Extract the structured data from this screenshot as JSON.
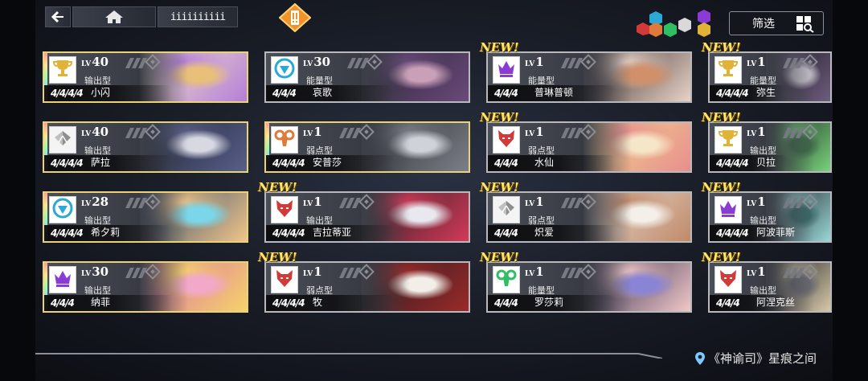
{
  "topbar": {
    "title": "iiiiiiiiii"
  },
  "filter": {
    "label": "筛选"
  },
  "colors": {
    "gold": "#e7c34a",
    "new": "#ffe36a",
    "frame": "#b9b9bd",
    "red": "#d23a3a",
    "purple": "#8a3bd6",
    "cyan": "#2aa8d6",
    "green": "#2fbf62"
  },
  "new_label": "NEW!",
  "cards": [
    {
      "id": "xiaoshan",
      "lv": "40",
      "type": "输出型",
      "name": "小闪",
      "icon": "trophy-icon",
      "icon_color": "#e0b236",
      "stars": "4/4/4/4",
      "new": false,
      "rainbow": true,
      "col": 0,
      "row": 0
    },
    {
      "id": "aige",
      "lv": "30",
      "type": "能量型",
      "name": "哀歌",
      "icon": "shield-icon",
      "icon_color": "#2aa8d6",
      "stars": "4/4/4",
      "new": false,
      "rainbow": false,
      "col": 1,
      "row": 0
    },
    {
      "id": "pulinpudun",
      "lv": "1",
      "type": "能量型",
      "name": "普琳普顿",
      "icon": "crown-icon",
      "icon_color": "#8a3bd6",
      "stars": "4/4/4",
      "new": true,
      "rainbow": false,
      "col": 2,
      "row": 0
    },
    {
      "id": "misheng",
      "lv": "1",
      "type": "能量型",
      "name": "弥生",
      "icon": "trophy-icon",
      "icon_color": "#e0b236",
      "stars": "4/4/4/4",
      "new": true,
      "rainbow": false,
      "col": 3,
      "row": 0
    },
    {
      "id": "sala",
      "lv": "40",
      "type": "输出型",
      "name": "萨拉",
      "icon": "wings-icon",
      "icon_color": "#d9d9d9",
      "stars": "4/4/4/4",
      "new": false,
      "rainbow": true,
      "col": 0,
      "row": 1
    },
    {
      "id": "anpusha",
      "lv": "1",
      "type": "弱点型",
      "name": "安普莎",
      "icon": "ram-icon",
      "icon_color": "#e07a3a",
      "stars": "4/4/4/4",
      "new": false,
      "rainbow": true,
      "col": 1,
      "row": 1
    },
    {
      "id": "shuixian",
      "lv": "1",
      "type": "弱点型",
      "name": "水仙",
      "icon": "wolf-icon",
      "icon_color": "#d23a3a",
      "stars": "4/4/4",
      "new": true,
      "rainbow": false,
      "col": 2,
      "row": 1
    },
    {
      "id": "beila",
      "lv": "1",
      "type": "输出型",
      "name": "贝拉",
      "icon": "trophy-icon",
      "icon_color": "#e0b236",
      "stars": "4/4/4/4",
      "new": true,
      "rainbow": false,
      "col": 3,
      "row": 1
    },
    {
      "id": "xixili",
      "lv": "28",
      "type": "输出型",
      "name": "希夕莉",
      "icon": "shield-icon",
      "icon_color": "#2aa8d6",
      "stars": "4/4/4/4",
      "new": false,
      "rainbow": true,
      "col": 0,
      "row": 2
    },
    {
      "id": "jiladiya",
      "lv": "1",
      "type": "输出型",
      "name": "吉拉蒂亚",
      "icon": "wolf-icon",
      "icon_color": "#d23a3a",
      "stars": "4/4/4/4",
      "new": true,
      "rainbow": false,
      "col": 1,
      "row": 2
    },
    {
      "id": "chiai",
      "lv": "1",
      "type": "弱点型",
      "name": "炽爱",
      "icon": "wings-icon",
      "icon_color": "#d9d9d9",
      "stars": "4/4/4",
      "new": true,
      "rainbow": false,
      "col": 2,
      "row": 2
    },
    {
      "id": "abofeisi",
      "lv": "1",
      "type": "输出型",
      "name": "阿波菲斯",
      "icon": "crown-icon",
      "icon_color": "#8a3bd6",
      "stars": "4/4/4/4",
      "new": true,
      "rainbow": false,
      "col": 3,
      "row": 2
    },
    {
      "id": "nafei",
      "lv": "30",
      "type": "输出型",
      "name": "纳菲",
      "icon": "crown-icon",
      "icon_color": "#8a3bd6",
      "stars": "4/4/4",
      "new": false,
      "rainbow": true,
      "col": 0,
      "row": 3
    },
    {
      "id": "mu",
      "lv": "1",
      "type": "弱点型",
      "name": "牧",
      "icon": "wolf-icon",
      "icon_color": "#d23a3a",
      "stars": "4/4/4/4",
      "new": true,
      "rainbow": false,
      "col": 1,
      "row": 3
    },
    {
      "id": "luosali",
      "lv": "1",
      "type": "能量型",
      "name": "罗莎莉",
      "icon": "ram-icon",
      "icon_color": "#2fbf62",
      "stars": "4/4/4",
      "new": true,
      "rainbow": false,
      "col": 2,
      "row": 3
    },
    {
      "id": "anieksi",
      "lv": "1",
      "type": "输出型",
      "name": "阿涅克丝",
      "icon": "wolf-icon",
      "icon_color": "#d23a3a",
      "stars": "4/4/4",
      "new": true,
      "rainbow": false,
      "col": 3,
      "row": 3
    }
  ],
  "footer": {
    "location": "《神谕司》星痕之间"
  }
}
